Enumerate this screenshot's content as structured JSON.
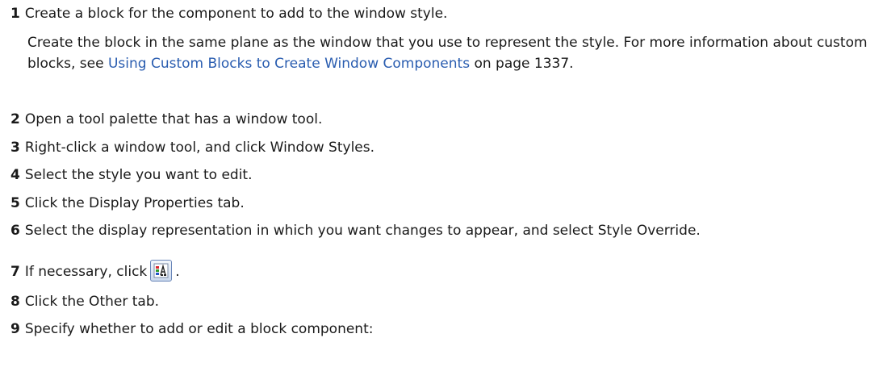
{
  "steps": [
    {
      "num": "1",
      "text": "Create a block for the component to add to the window style."
    },
    {
      "num": "2",
      "text": "Open a tool palette that has a window tool."
    },
    {
      "num": "3",
      "text": "Right-click a window tool, and click Window Styles."
    },
    {
      "num": "4",
      "text": "Select the style you want to edit."
    },
    {
      "num": "5",
      "text": "Click the Display Properties tab."
    },
    {
      "num": "6",
      "text": "Select the display representation in which you want changes to appear, and select Style Override."
    },
    {
      "num": "7",
      "text_before": "If necessary, click",
      "text_after": ".",
      "icon": "display-properties-icon"
    },
    {
      "num": "8",
      "text": "Click the Other tab."
    },
    {
      "num": "9",
      "text": "Specify whether to add or edit a block component:"
    }
  ],
  "step1_detail": {
    "before": "Create the block in the same plane as the window that you use to represent the style. For more information about custom blocks, see ",
    "link": "Using Custom Blocks to Create Window Components",
    "after": " on page 1337."
  },
  "colors": {
    "link": "#2a5db0",
    "text": "#1a1a1a"
  }
}
